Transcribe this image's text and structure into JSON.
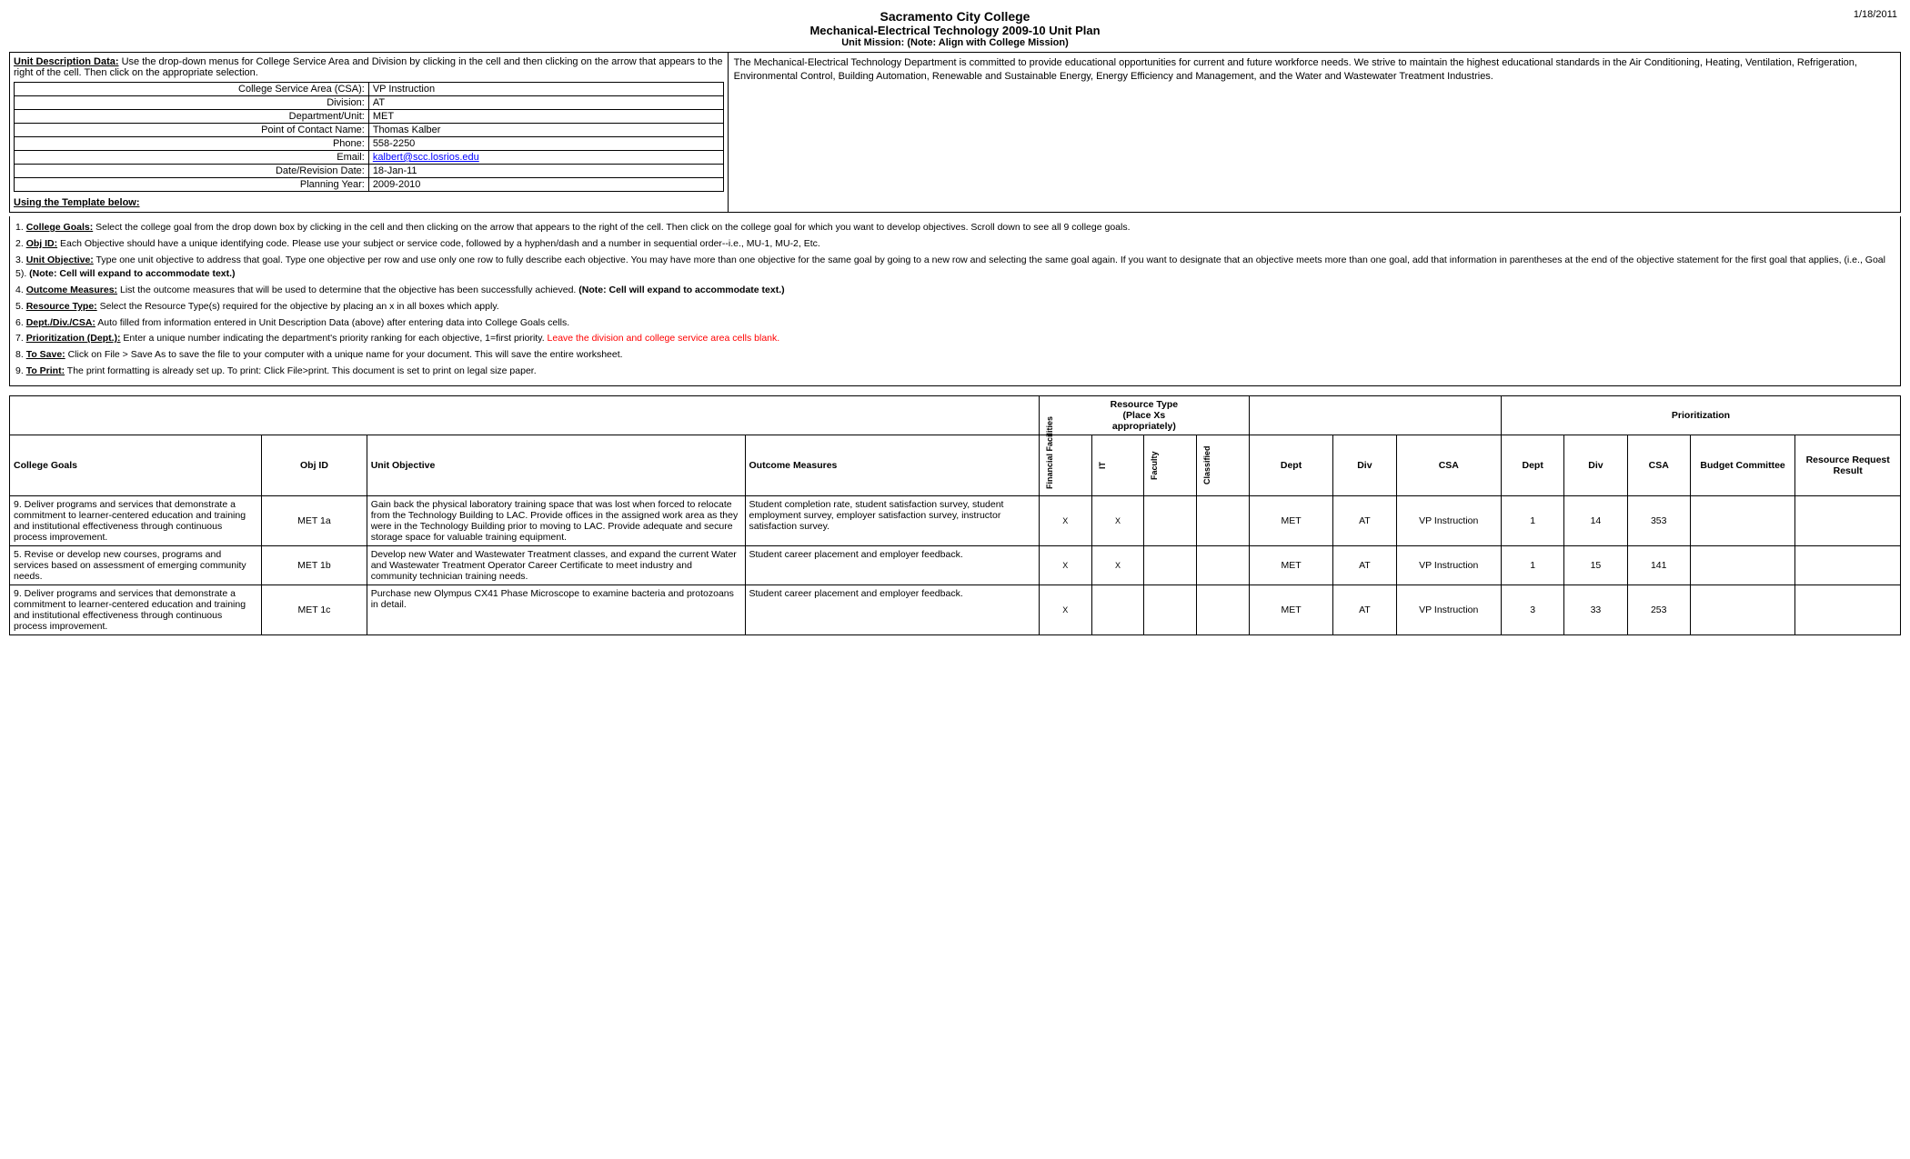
{
  "header": {
    "title1": "Sacramento City College",
    "title2": "Mechanical-Electrical Technology 2009-10 Unit Plan",
    "title3": "Unit Mission:  (Note:  Align with College Mission)",
    "date": "1/18/2011"
  },
  "top_left": {
    "desc_title_bold": "Unit Description Data:",
    "desc_text": " Use the drop-down menus for College Service Area and Division by clicking in the cell and then clicking on the arrow that appears to the right of the cell. Then click on the appropriate selection.",
    "fields": [
      {
        "label": "College Service Area (CSA):",
        "value": "VP Instruction"
      },
      {
        "label": "Division:",
        "value": "AT"
      },
      {
        "label": "Department/Unit:",
        "value": "MET"
      },
      {
        "label": "Point of Contact Name:",
        "value": "Thomas Kalber"
      },
      {
        "label": "Phone:",
        "value": "558-2250"
      },
      {
        "label": "Email:",
        "value": "kalbert@scc.losrios.edu",
        "is_link": true
      },
      {
        "label": "Date/Revision Date:",
        "value": "18-Jan-11"
      },
      {
        "label": "Planning Year:",
        "value": "2009-2010"
      }
    ],
    "template_note": "Using the Template below:"
  },
  "top_right": {
    "text": "The Mechanical-Electrical Technology Department is committed to provide educational opportunities for current and future workforce needs. We strive to maintain the highest educational standards in the Air Conditioning, Heating, Ventilation, Refrigeration, Environmental Control, Building Automation, Renewable and Sustainable Energy, Energy Efficiency and Management, and the Water and Wastewater Treatment Industries."
  },
  "instructions": [
    {
      "num": "1.",
      "bold_part": "College Goals:",
      "text": " Select the college goal from the drop down box by clicking in the cell and then clicking on the arrow that appears to the right of the cell. Then click on the college goal for which you want to develop objectives. Scroll down to see all 9 college goals."
    },
    {
      "num": "2.",
      "bold_part": "Obj ID:",
      "text": " Each Objective should have a unique identifying code.  Please use your subject or service code, followed by a hyphen/dash and a number in sequential order--i.e., MU-1, MU-2, Etc."
    },
    {
      "num": "3.",
      "bold_part": "Unit Objective:",
      "text": " Type one unit objective to address that goal. Type one objective per row and use only one row to fully describe each objective.  You may have more than one objective for the same goal by going to a new row and selecting the same goal again.  If you want to designate that an objective meets more than one goal, add that information in parentheses at the end of the objective statement for the first goal that applies, (i.e., Goal 5).",
      "bold_end": " (Note: Cell will expand to accommodate text.)"
    },
    {
      "num": "4.",
      "bold_part": "Outcome Measures:",
      "text": " List the outcome measures that will be used to determine that the objective has been successfully achieved.",
      "bold_end": " (Note: Cell will expand to accommodate text.)"
    },
    {
      "num": "5.",
      "bold_part": "Resource Type:",
      "text": " Select the Resource Type(s) required for the objective by placing an x in all boxes which apply."
    },
    {
      "num": "6.",
      "bold_part": "Dept./Div./CSA:",
      "text": " Auto filled from information entered in Unit Description Data (above) after entering data into College Goals cells."
    },
    {
      "num": "7.",
      "bold_part": "Prioritization (Dept.):",
      "text": " Enter a unique number indicating the department's priority ranking for each objective, 1=first priority. ",
      "red_text": "Leave the division and college service area cells blank."
    },
    {
      "num": "8.",
      "bold_part": "To Save:",
      "text": " Click on File > Save As to save the file to your computer with a unique name for your document.  This will save the entire worksheet."
    },
    {
      "num": "9.",
      "bold_part": "To Print:",
      "text": " The print formatting is already set up. To print:  Click File>print. This document is set to print on legal size paper."
    }
  ],
  "table": {
    "resource_type_header": "Resource Type\n(Place Xs\nappropriately)",
    "prioritization_header": "Prioritization",
    "col_headers": {
      "college_goals": "College Goals",
      "obj_id": "Obj ID",
      "unit_objective": "Unit Objective",
      "outcome_measures": "Outcome Measures",
      "financial_facilities": "Financial Facilities",
      "it": "IT",
      "faculty": "Faculty",
      "classified": "Classified",
      "dept": "Dept",
      "div": "Div",
      "csa": "CSA",
      "p_dept": "Dept",
      "p_div": "Div",
      "p_csa": "CSA",
      "budget_committee": "Budget Committee",
      "resource_request_result": "Resource Request Result"
    },
    "rows": [
      {
        "college_goals": "9. Deliver programs and services that demonstrate a commitment to learner-centered education and training and institutional effectiveness through continuous process improvement.",
        "obj_id": "MET 1a",
        "unit_objective": "Gain back the physical laboratory training space that was lost when forced to relocate from the Technology Building to LAC. Provide offices in the assigned work area as they were in the Technology Building prior to moving to LAC. Provide adequate and secure storage space for valuable training equipment.",
        "outcome_measures": "Student completion rate, student satisfaction survey, student employment survey, employer satisfaction survey, instructor satisfaction survey.",
        "financial": "X",
        "it": "X",
        "faculty": "",
        "classified": "",
        "dept_val": "MET",
        "div_val": "AT",
        "csa_val": "VP Instruction",
        "p_dept": "1",
        "p_div": "14",
        "p_csa": "353",
        "budget": "",
        "resource": ""
      },
      {
        "college_goals": "5. Revise or develop new courses, programs and services based on assessment of emerging community needs.",
        "obj_id": "MET 1b",
        "unit_objective": "Develop new Water and Wastewater Treatment classes, and expand the current Water and Wastewater Treatment Operator Career Certificate to meet industry and community technician training needs.",
        "outcome_measures": "Student career placement and employer feedback.",
        "financial": "X",
        "it": "X",
        "faculty": "",
        "classified": "",
        "dept_val": "MET",
        "div_val": "AT",
        "csa_val": "VP Instruction",
        "p_dept": "1",
        "p_div": "15",
        "p_csa": "141",
        "budget": "",
        "resource": ""
      },
      {
        "college_goals": "9. Deliver programs and services that demonstrate a commitment to learner-centered education and training and institutional effectiveness through continuous process improvement.",
        "obj_id": "MET 1c",
        "unit_objective": "Purchase new Olympus CX41 Phase Microscope to examine bacteria and protozoans in detail.",
        "outcome_measures": "Student career placement and employer feedback.",
        "financial": "X",
        "it": "",
        "faculty": "",
        "classified": "",
        "dept_val": "MET",
        "div_val": "AT",
        "csa_val": "VP Instruction",
        "p_dept": "3",
        "p_div": "33",
        "p_csa": "253",
        "budget": "",
        "resource": ""
      }
    ]
  }
}
